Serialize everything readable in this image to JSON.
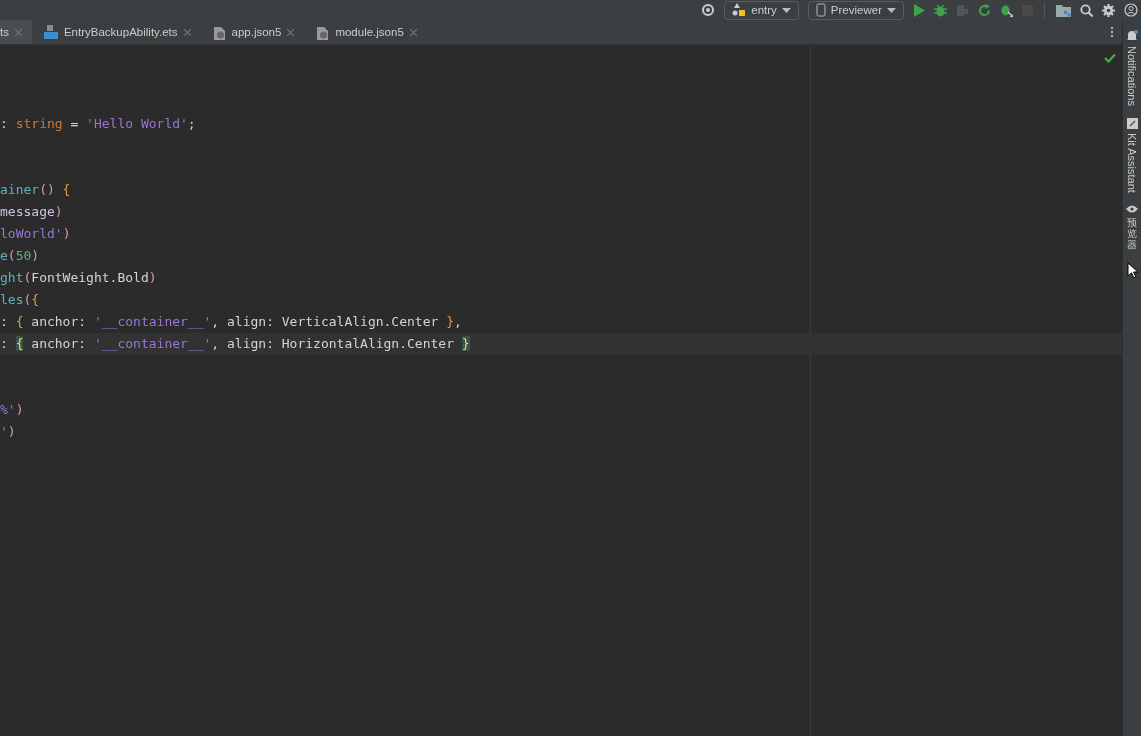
{
  "toolbar": {
    "module_selector": {
      "label": "entry"
    },
    "device_selector": {
      "label": "Previewer"
    }
  },
  "tabs": [
    {
      "label": "ts",
      "selected": true
    },
    {
      "label": "EntryBackupAbility.ets",
      "selected": false,
      "kind": "ets"
    },
    {
      "label": "app.json5",
      "selected": false,
      "kind": "json"
    },
    {
      "label": "module.json5",
      "selected": false,
      "kind": "json"
    }
  ],
  "editor": {
    "lines": [
      {
        "kind": "blank"
      },
      {
        "kind": "blank"
      },
      {
        "kind": "blank"
      },
      {
        "kind": "code",
        "tokens": [
          {
            "text": ": ",
            "kind": "plain"
          },
          {
            "text": "string",
            "kind": "type"
          },
          {
            "text": " = ",
            "kind": "plain"
          },
          {
            "text": "'Hello World'",
            "kind": "string"
          },
          {
            "text": ";",
            "kind": "plain"
          }
        ]
      },
      {
        "kind": "blank"
      },
      {
        "kind": "blank"
      },
      {
        "kind": "code",
        "tokens": [
          {
            "text": "ainer",
            "kind": "func"
          },
          {
            "text": "()",
            "kind": "paren"
          },
          {
            "text": " {",
            "kind": "brace"
          }
        ]
      },
      {
        "kind": "code",
        "tokens": [
          {
            "text": "message",
            "kind": "field"
          },
          {
            "text": ")",
            "kind": "paren"
          }
        ]
      },
      {
        "kind": "code",
        "tokens": [
          {
            "text": "loWorld'",
            "kind": "string"
          },
          {
            "text": ")",
            "kind": "paren"
          }
        ]
      },
      {
        "kind": "code",
        "tokens": [
          {
            "text": "e",
            "kind": "func"
          },
          {
            "text": "(",
            "kind": "paren"
          },
          {
            "text": "50",
            "kind": "number"
          },
          {
            "text": ")",
            "kind": "paren"
          }
        ]
      },
      {
        "kind": "code",
        "tokens": [
          {
            "text": "ght",
            "kind": "func"
          },
          {
            "text": "(",
            "kind": "paren"
          },
          {
            "text": "FontWeight.Bold",
            "kind": "plain"
          },
          {
            "text": ")",
            "kind": "paren"
          }
        ]
      },
      {
        "kind": "code",
        "tokens": [
          {
            "text": "les",
            "kind": "func"
          },
          {
            "text": "(",
            "kind": "paren"
          },
          {
            "text": "{",
            "kind": "brace"
          }
        ]
      },
      {
        "kind": "code",
        "tokens": [
          {
            "text": ": ",
            "kind": "plain"
          },
          {
            "text": "{",
            "kind": "brace"
          },
          {
            "text": " anchor: ",
            "kind": "plain"
          },
          {
            "text": "'__container__'",
            "kind": "string"
          },
          {
            "text": ", align: ",
            "kind": "plain"
          },
          {
            "text": "VerticalAlign.Center",
            "kind": "plain"
          },
          {
            "text": " }",
            "kind": "brace"
          },
          {
            "text": ",",
            "kind": "plain"
          }
        ]
      },
      {
        "kind": "code",
        "current": true,
        "tokens": [
          {
            "text": ": ",
            "kind": "plain"
          },
          {
            "text": "{",
            "kind": "match"
          },
          {
            "text": " anchor: ",
            "kind": "plain"
          },
          {
            "text": "'__container__'",
            "kind": "string"
          },
          {
            "text": ", align: ",
            "kind": "plain"
          },
          {
            "text": "HorizontalAlign.Center ",
            "kind": "plain"
          },
          {
            "text": "}",
            "kind": "match"
          }
        ]
      },
      {
        "kind": "blank"
      },
      {
        "kind": "blank"
      },
      {
        "kind": "code",
        "tokens": [
          {
            "text": "%'",
            "kind": "string"
          },
          {
            "text": ")",
            "kind": "paren"
          }
        ]
      },
      {
        "kind": "code",
        "tokens": [
          {
            "text": "'",
            "kind": "string"
          },
          {
            "text": ")",
            "kind": "paren"
          }
        ]
      }
    ]
  },
  "side_tabs": [
    {
      "label": "Notifications",
      "kind": "bell"
    },
    {
      "label": "Kit Assistant",
      "kind": "kit"
    },
    {
      "label": "预览器",
      "kind": "eye"
    }
  ]
}
